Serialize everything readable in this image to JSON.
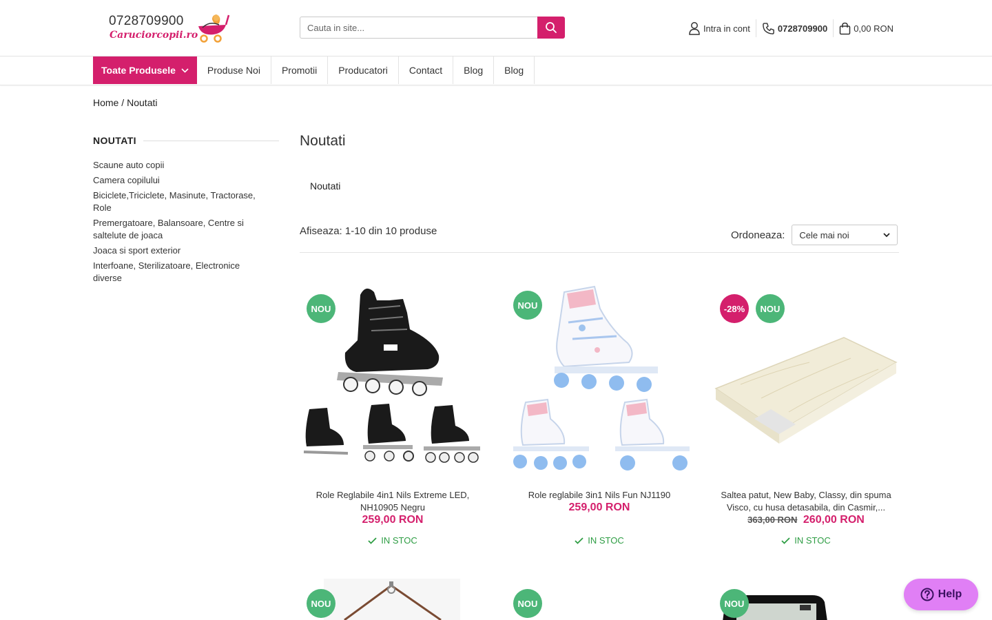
{
  "header": {
    "logo_phone": "0728709900",
    "logo_name": "Caruciorcopii.ro",
    "search_placeholder": "Cauta in site...",
    "account_label": "Intra in cont",
    "phone": "0728709900",
    "cart_total": "0,00 RON"
  },
  "nav": {
    "all_products": "Toate Produsele",
    "items": [
      "Produse Noi",
      "Promotii",
      "Producatori",
      "Contact",
      "Blog",
      "Blog"
    ]
  },
  "breadcrumb": {
    "home": "Home /",
    "current": "Noutati"
  },
  "sidebar": {
    "title": "NOUTATI",
    "items": [
      "Scaune auto copii",
      "Camera copilului",
      "Biciclete,Triciclete, Masinute, Tractorase, Role",
      "Premergatoare, Balansoare, Centre si saltelute de joaca",
      "Joaca si sport exterior",
      "Interfoane, Sterilizatoare, Electronice diverse"
    ]
  },
  "main": {
    "title": "Noutati",
    "subcategory": "Noutati",
    "count_text": "Afiseaza: 1-10 din 10 produse",
    "sort_label": "Ordoneaza:",
    "sort_value": "Cele mai noi"
  },
  "products": [
    {
      "name": "Role Reglabile 4in1 Nils Extreme LED, NH10905 Negru",
      "price": "259,00 RON",
      "old_price": "",
      "discount": "",
      "badge": "NOU",
      "stock": "IN STOC"
    },
    {
      "name": "Role reglabile 3in1 Nils Fun NJ1190",
      "price": "259,00 RON",
      "old_price": "",
      "discount": "",
      "badge": "NOU",
      "stock": "IN STOC"
    },
    {
      "name": "Saltea patut, New Baby, Classy, din spuma Visco, cu husa detasabila, din Casmir,...",
      "price": "260,00 RON",
      "old_price": "363,00 RON",
      "discount": "-28%",
      "badge": "NOU",
      "stock": "IN STOC"
    },
    {
      "badge": "NOU"
    },
    {
      "badge": "NOU"
    },
    {
      "badge": "NOU"
    }
  ],
  "help": {
    "label": "Help"
  },
  "colors": {
    "accent": "#d41f6c",
    "new_badge": "#4cb678",
    "stock": "#2e9d44",
    "help": "#e07ff5"
  }
}
